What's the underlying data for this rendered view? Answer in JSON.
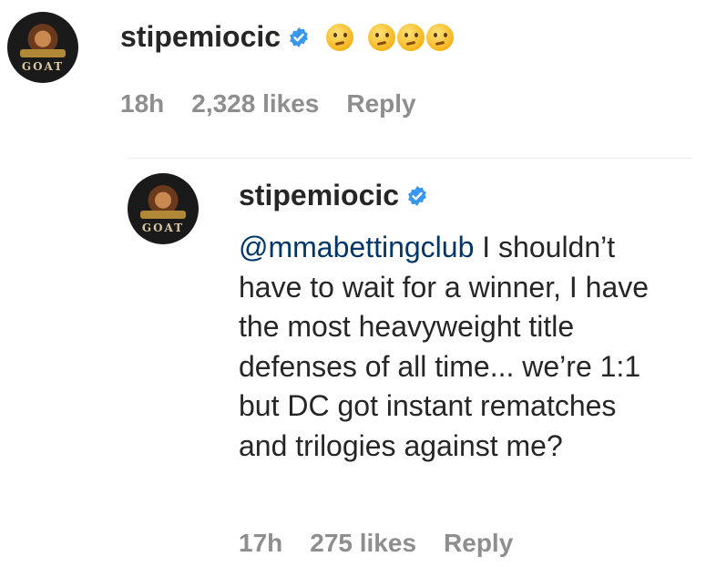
{
  "comment": {
    "username": "stipemiocic",
    "emoji_names": [
      "thinking-face-icon",
      "thinking-face-icon",
      "thinking-face-icon",
      "thinking-face-icon"
    ],
    "time": "18h",
    "likes": "2,328 likes",
    "reply_label": "Reply"
  },
  "reply": {
    "username": "stipemiocic",
    "mention": "@mmabettingclub",
    "text": " I shouldn’t have to wait for a winner, I have the most heavyweight title defenses of all time... we’re 1:1 but DC got instant rematches and trilogies against me?",
    "time": "17h",
    "likes": "275 likes",
    "reply_label": "Reply"
  },
  "avatar_text": "GOAT",
  "colors": {
    "verified": "#3897f0",
    "text": "#262626",
    "muted": "#8e8e8e",
    "mention": "#00376b"
  }
}
